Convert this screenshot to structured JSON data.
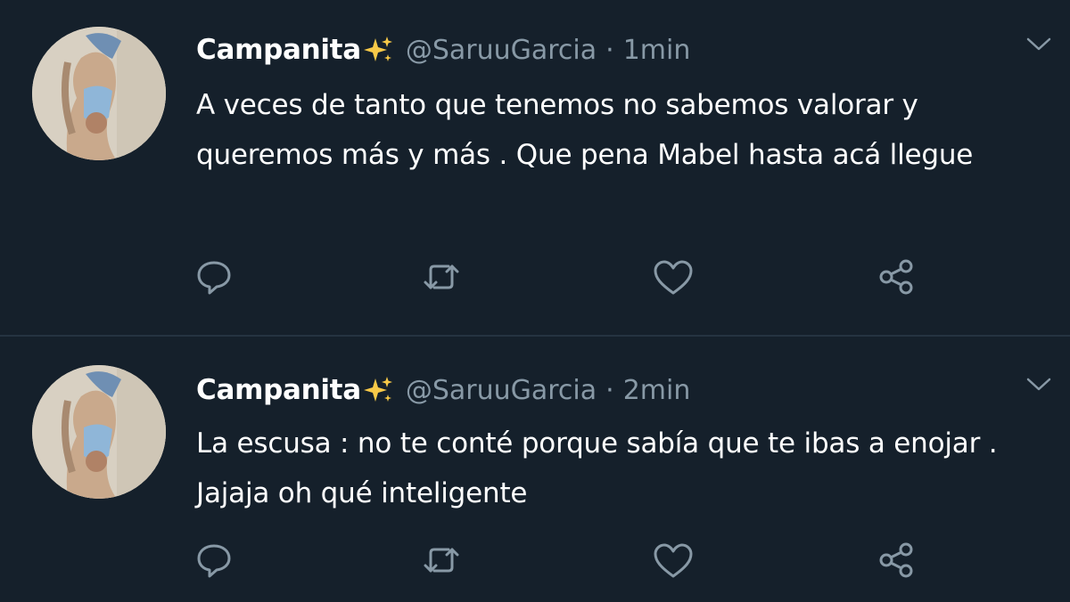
{
  "colors": {
    "background": "#15202b",
    "text_primary": "#ffffff",
    "text_secondary": "#8899a6",
    "divider": "#253341",
    "sparkle": "#f7c948"
  },
  "tweets": [
    {
      "display_name": "Campanita",
      "name_emoji": "sparkles-icon",
      "handle": "@SaruuGarcia",
      "separator": "·",
      "time": "1min",
      "text": "A veces de tanto que tenemos no sabemos valorar y queremos más y más . Que pena Mabel hasta acá llegue",
      "actions": [
        "reply-icon",
        "retweet-icon",
        "like-icon",
        "share-icon"
      ]
    },
    {
      "display_name": "Campanita",
      "name_emoji": "sparkles-icon",
      "handle": "@SaruuGarcia",
      "separator": "·",
      "time": "2min",
      "text": "La escusa : no te conté porque sabía que te ibas a enojar . Jajaja oh qué inteligente",
      "actions": [
        "reply-icon",
        "retweet-icon",
        "like-icon",
        "share-icon"
      ]
    }
  ]
}
